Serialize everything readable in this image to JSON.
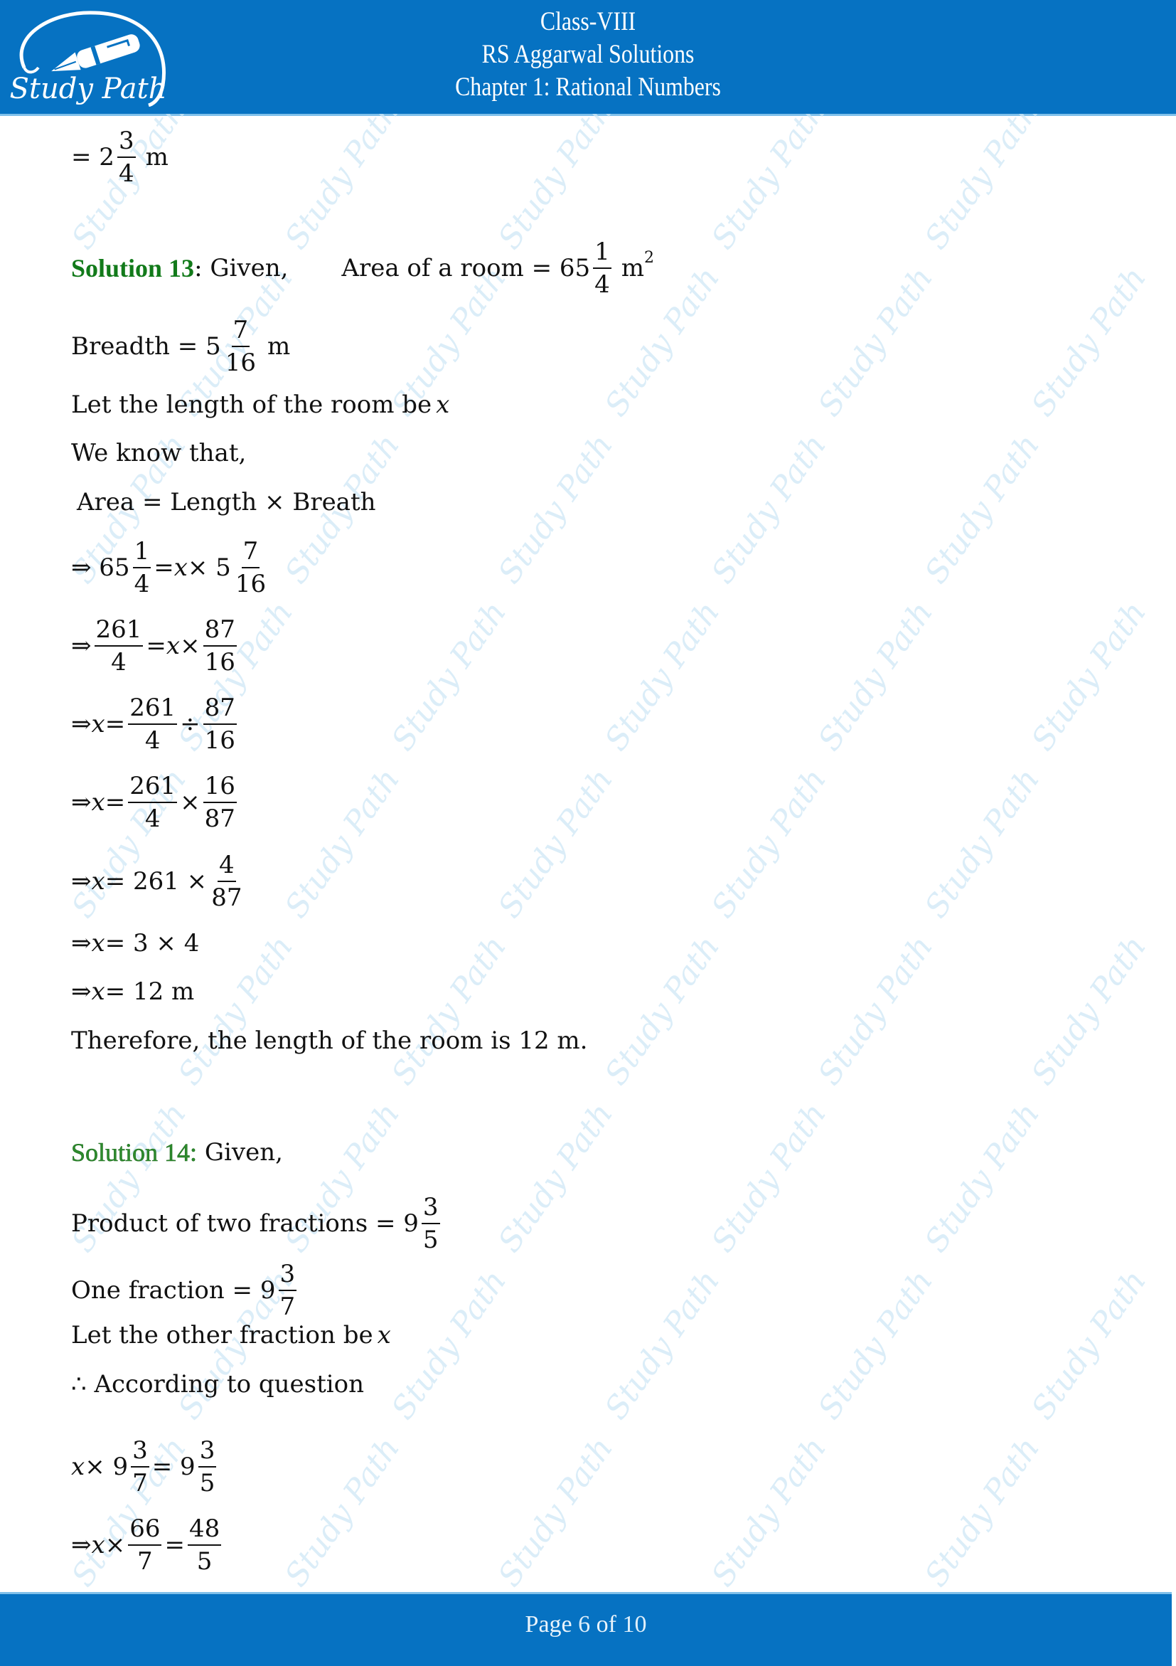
{
  "header": {
    "logo_text": "Study Path",
    "line1": "Class-VIII",
    "line2": "RS Aggarwal Solutions",
    "line3": "Chapter 1: Rational Numbers"
  },
  "footer": {
    "page_prefix": "Page",
    "page_current": "6",
    "page_of": "of",
    "page_total": "10"
  },
  "watermark_text": "Study Path",
  "prev": {
    "eq": "= 2",
    "frac_n": "3",
    "frac_d": "4",
    "unit": "m"
  },
  "solution13": {
    "label": "Solution 13",
    "given": ": Given,",
    "area_label": "Area of a room = 65",
    "area_frac_n": "1",
    "area_frac_d": "4",
    "area_unit": "m",
    "area_unit_sup": "2",
    "breadth_label": "Breadth = 5",
    "breadth_frac_n": "7",
    "breadth_frac_d": "16",
    "breadth_unit": "m",
    "let_text": "Let the length of the room be ",
    "var": "x",
    "know": "We know that,",
    "formula": "Area = Length × Breath",
    "step1": {
      "a": "⇒ 65",
      "f1n": "1",
      "f1d": "4",
      "b": "= ",
      "c": " × 5",
      "f2n": "7",
      "f2d": "16"
    },
    "step2": {
      "a": "⇒",
      "f1n": "261",
      "f1d": "4",
      "b": "= ",
      "c": " ×",
      "f2n": "87",
      "f2d": "16"
    },
    "step3": {
      "a": "⇒ ",
      "b": " =",
      "f1n": "261",
      "f1d": "4",
      "op": "÷",
      "f2n": "87",
      "f2d": "16"
    },
    "step4": {
      "a": "⇒ ",
      "b": " =",
      "f1n": "261",
      "f1d": "4",
      "op": "×",
      "f2n": "16",
      "f2d": "87"
    },
    "step5": {
      "a": "⇒ ",
      "b": " = 261 ×",
      "f2n": "4",
      "f2d": "87"
    },
    "step6": {
      "a": "⇒ ",
      "b": " = 3 × 4"
    },
    "step7": {
      "a": "⇒ ",
      "b": " = 12 m"
    },
    "conclusion": "Therefore, the length of the room is 12 m."
  },
  "solution14": {
    "label": "Solution 14:",
    "given": " Given,",
    "product_label": "Product of two fractions = 9",
    "product_frac_n": "3",
    "product_frac_d": "5",
    "one_label": "One fraction = 9",
    "one_frac_n": "3",
    "one_frac_d": "7",
    "let_text": "Let the other fraction be ",
    "var": "x",
    "according": "∴ According to question",
    "eq1": {
      "c": " × 9",
      "f1n": "3",
      "f1d": "7",
      "b": "= 9",
      "f2n": "3",
      "f2d": "5"
    },
    "eq2": {
      "a": "⇒ ",
      "c": " ×",
      "f1n": "66",
      "f1d": "7",
      "b": "=",
      "f2n": "48",
      "f2d": "5"
    }
  }
}
